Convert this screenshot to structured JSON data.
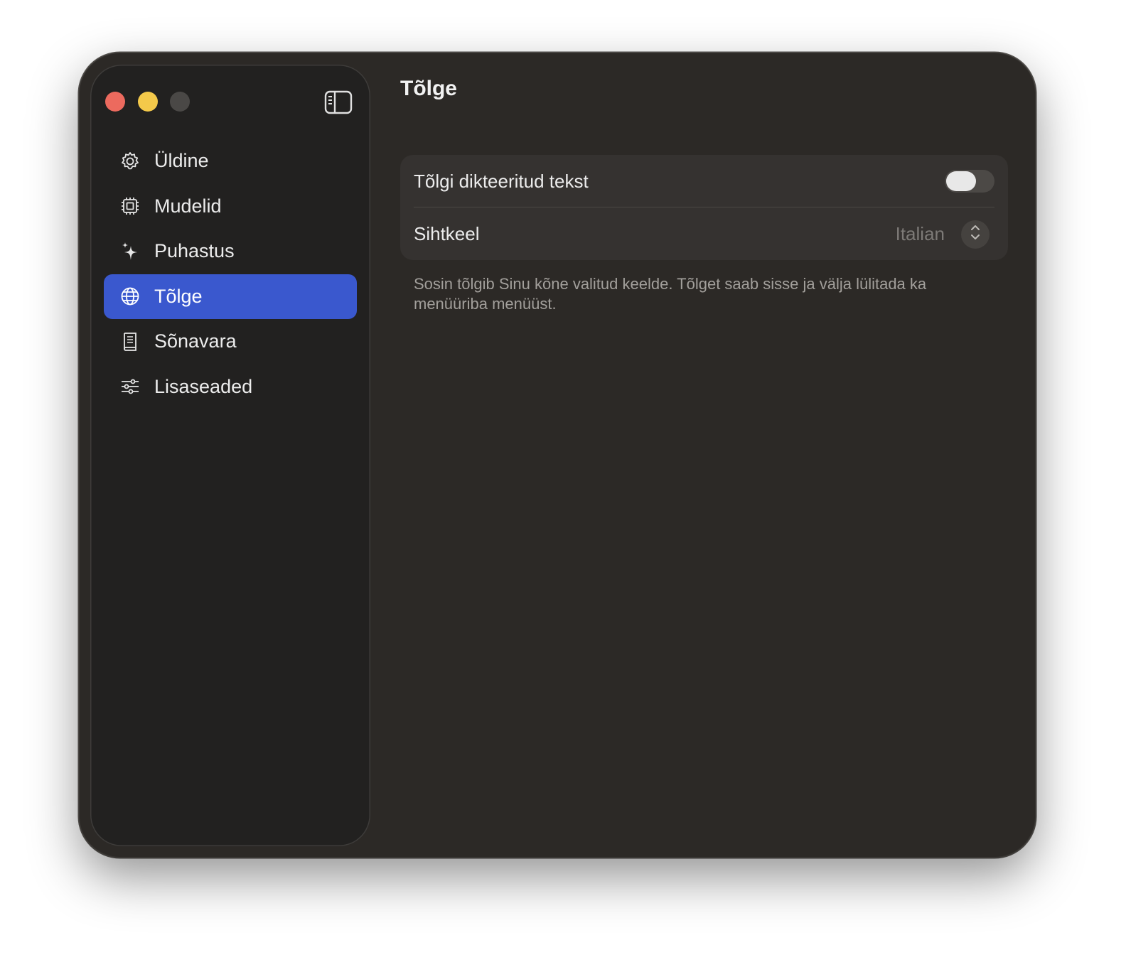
{
  "sidebar": {
    "items": [
      {
        "label": "Üldine",
        "icon": "gear-icon"
      },
      {
        "label": "Mudelid",
        "icon": "chip-icon"
      },
      {
        "label": "Puhastus",
        "icon": "sparkles-icon"
      },
      {
        "label": "Tõlge",
        "icon": "globe-icon",
        "active": true
      },
      {
        "label": "Sõnavara",
        "icon": "book-icon"
      },
      {
        "label": "Lisaseaded",
        "icon": "sliders-icon"
      }
    ]
  },
  "main": {
    "title": "Tõlge",
    "translate_toggle": {
      "label": "Tõlgi dikteeritud tekst",
      "on": false
    },
    "target_language": {
      "label": "Sihtkeel",
      "value": "Italian"
    },
    "description": "Sosin tõlgib Sinu kõne valitud keelde. Tõlget saab sisse ja välja lülitada ka menüüriba menüüst."
  },
  "colors": {
    "accent": "#3a58ce",
    "window_bg": "#2c2926",
    "sidebar_bg": "#222120",
    "close": "#ec6a5e",
    "minimize": "#f4c94a"
  }
}
